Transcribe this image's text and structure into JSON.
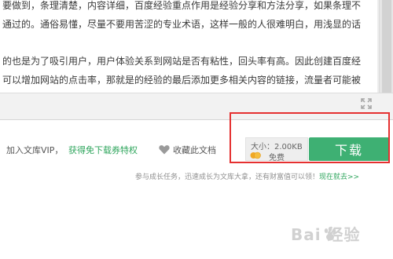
{
  "document": {
    "lines": [
      "要做到，条理清楚，内容详细，百度经验重点作用是经验分享和方法分享，如果条理不",
      "通过的。通俗易懂，尽量不要用苦涩的专业术语，这样一般的人很难明白，用浅显的话",
      "的也是为了吸引用户，用户体验关系到网站是否有粘性，回头率有高。因此创建百度经",
      "可以增加网站的点击率，那就是的经验的最后添加更多相关内容的链接，流量者可能被"
    ]
  },
  "actions": {
    "vip_label": "加入文库VIP，",
    "vip_link": "获得免下载券特权",
    "favorite_label": "收藏此文档",
    "size_label": "大小：2.00KB",
    "free_label": "免费",
    "download_label": "下载"
  },
  "task": {
    "text": "参与成长任务，迅速成长为文库大拿，还有财富值可以领！",
    "link": "现在就去>>"
  },
  "watermark": {
    "text": "Bai  经验",
    "icon": "baidu-paw-icon"
  },
  "colors": {
    "accent_green": "#3eb073",
    "link_green": "#2ea55c",
    "highlight_red": "#e53030"
  },
  "icons": {
    "expand": "expand-arrows-icon",
    "favorite": "heart-icon",
    "coin": "coin-icon"
  }
}
